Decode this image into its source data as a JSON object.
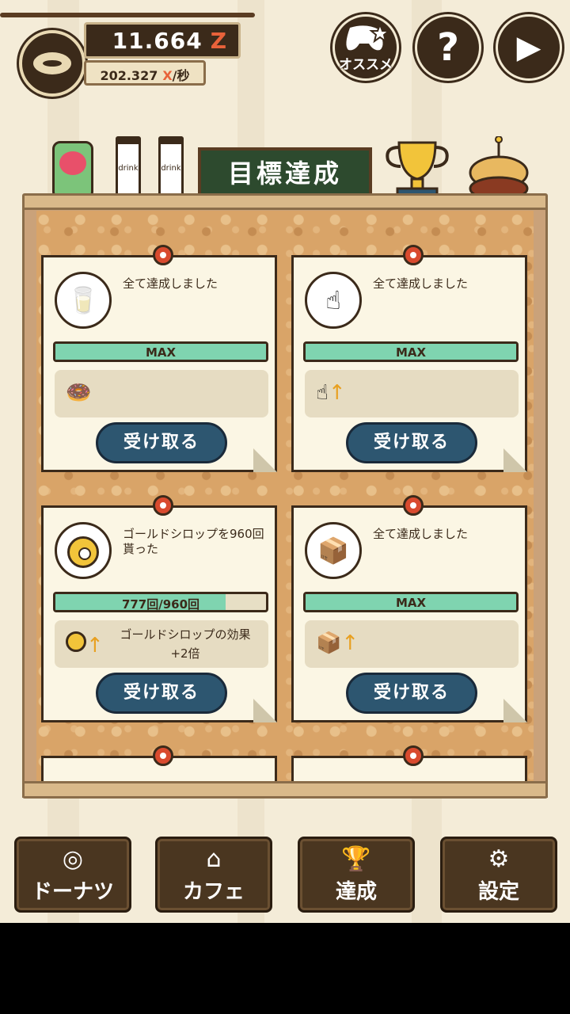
{
  "header": {
    "money": "11.664",
    "money_unit": "Z",
    "rate_value": "202.327",
    "rate_unit_x": "X",
    "rate_unit_suffix": "/秒",
    "recommend_label": "オススメ",
    "help_label": "?",
    "play_label": "▶"
  },
  "board": {
    "title": "目標達成",
    "drink_label_1": "drink",
    "drink_label_2": "drink"
  },
  "cards": [
    {
      "title": "全て達成しました",
      "progress_text": "MAX",
      "progress": 1.0,
      "reward_text": "",
      "reward_text_2": "",
      "claim_label": "受け取る",
      "icon": "milk-carton-icon",
      "reward_icon": "donut-box-icon"
    },
    {
      "title": "全て達成しました",
      "progress_text": "MAX",
      "progress": 1.0,
      "reward_text": "",
      "reward_text_2": "",
      "claim_label": "受け取る",
      "icon": "tap-hand-icon",
      "reward_icon": "tap-up-icon"
    },
    {
      "title": "ゴールドシロップを960回貰った",
      "progress_text": "777回/960回",
      "progress": 0.809,
      "reward_text": "ゴールドシロップの効果",
      "reward_text_2": "+2倍",
      "claim_label": "受け取る",
      "icon": "gold-donut-icon",
      "reward_icon": "gold-donut-up-icon"
    },
    {
      "title": "全て達成しました",
      "progress_text": "MAX",
      "progress": 1.0,
      "reward_text": "",
      "reward_text_2": "",
      "claim_label": "受け取る",
      "icon": "milk-carton-icon",
      "reward_icon": "carton-up-icon"
    }
  ],
  "nav": {
    "donut": "ドーナツ",
    "cafe": "カフェ",
    "achievement": "達成",
    "settings": "設定"
  },
  "colors": {
    "dark_brown": "#3b2a1a",
    "accent_red": "#e8623a",
    "progress_green": "#7fd4b0",
    "button_blue": "#2d5670"
  }
}
